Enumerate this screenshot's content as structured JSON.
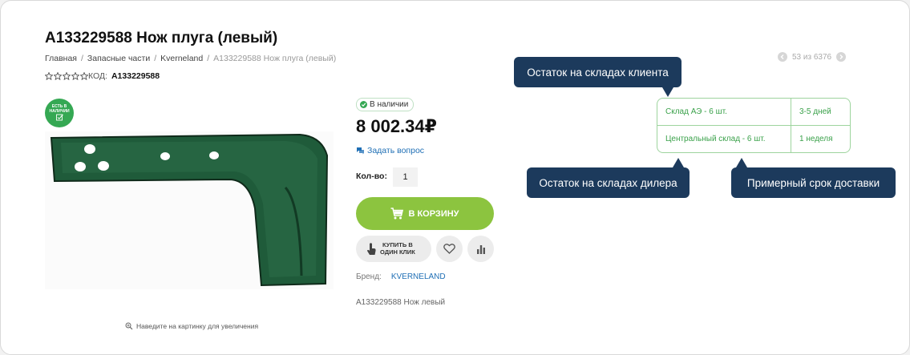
{
  "product": {
    "title": "A133229588 Нож плуга (левый)",
    "sku_label": "КОД:",
    "sku_value": "A133229588",
    "rating": 0,
    "price": "8 002.34₽",
    "availability": "В наличии",
    "ask_question": "Задать вопрос",
    "qty_label": "Кол-во:",
    "qty_value": "1",
    "cart_button": "В КОРЗИНУ",
    "one_click_line1": "КУПИТЬ В",
    "one_click_line2": "ОДИН КЛИК",
    "brand_label": "Бренд:",
    "brand_value": "KVERNELAND",
    "description": "A133229588 Нож левый",
    "badge_line1": "ЕСТЬ В",
    "badge_line2": "НАЛИЧИИ",
    "zoom_hint": "Наведите на картинку для увеличения"
  },
  "breadcrumb": [
    "Главная",
    "Запасные части",
    "Kverneland",
    "A133229588 Нож плуга (левый)"
  ],
  "pager": {
    "text": "53 из 6376"
  },
  "stock_table": [
    {
      "store": "Склад АЭ - 6 шт.",
      "delivery": "3-5 дней"
    },
    {
      "store": "Центральный склад - 6 шт.",
      "delivery": "1 неделя"
    }
  ],
  "callouts": {
    "client_stock": "Остаток на складах клиента",
    "dealer_stock": "Остаток на складах дилера",
    "delivery_time": "Примерный срок доставки"
  },
  "icons": [
    "star-icon",
    "chevron-left-icon",
    "chevron-right-icon",
    "check-icon",
    "chat-icon",
    "cart-icon",
    "hand-pointer-icon",
    "heart-icon",
    "compare-icon",
    "zoom-icon"
  ],
  "colors": {
    "accent_green": "#8cc43f",
    "stock_green": "#35a853",
    "link_blue": "#1f6fb5",
    "callout_navy": "#1c3a5c"
  }
}
